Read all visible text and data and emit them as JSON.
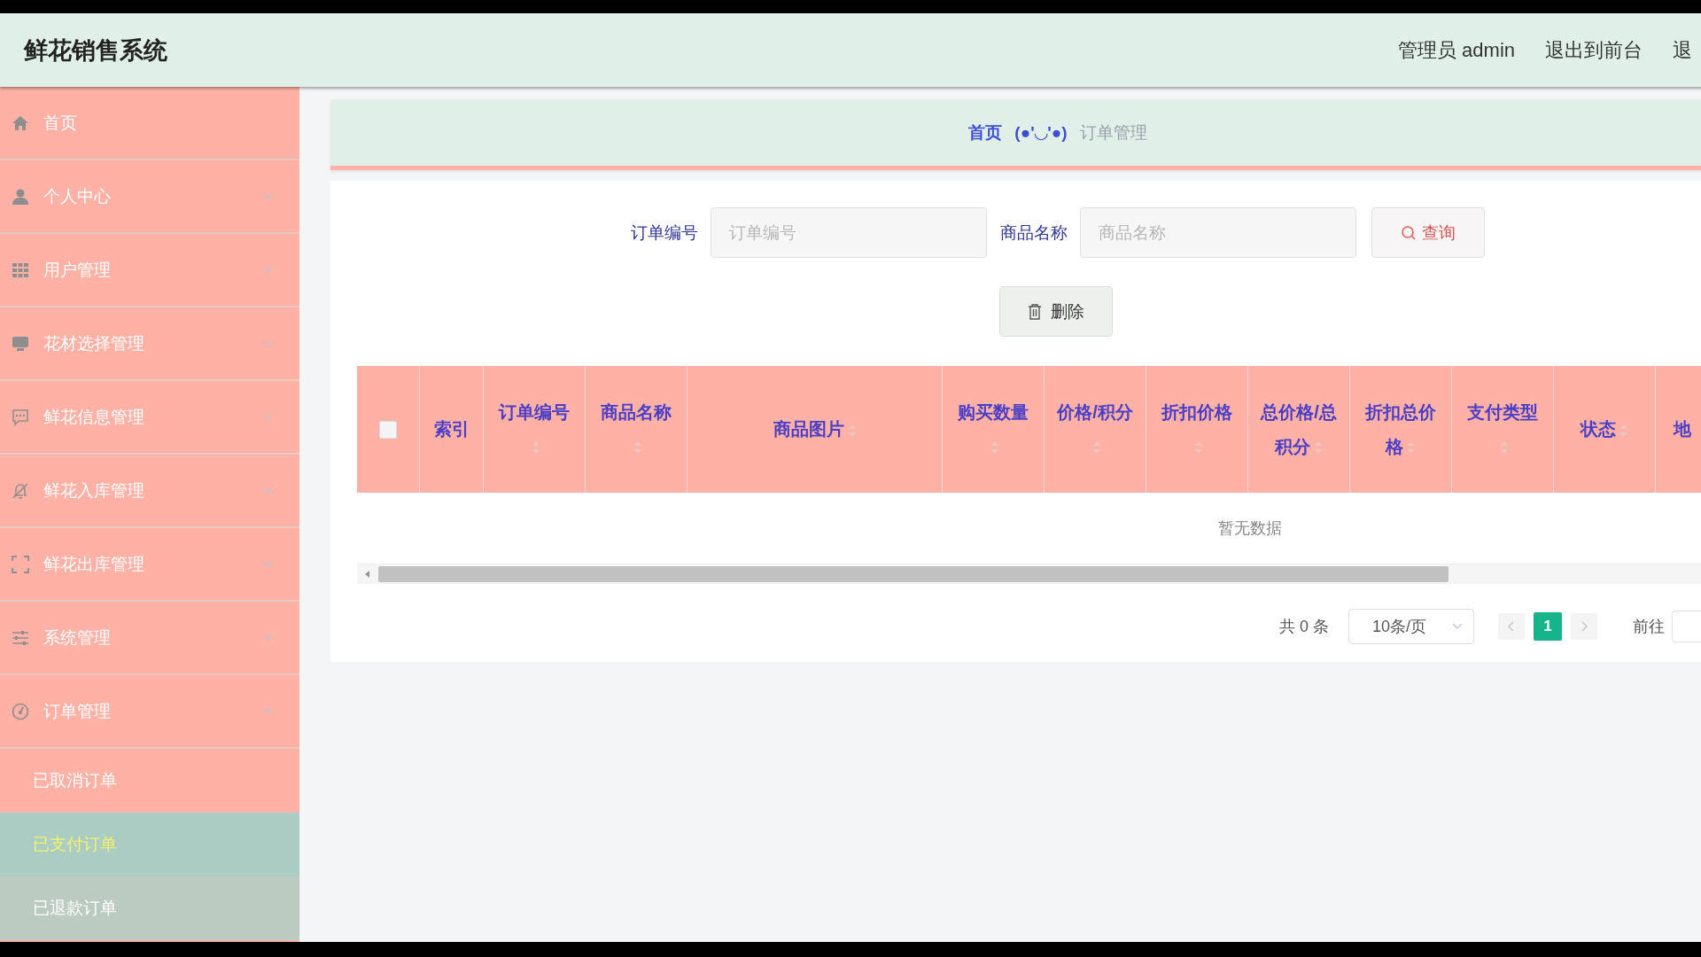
{
  "header": {
    "title": "鲜花销售系统",
    "links": [
      "管理员 admin",
      "退出到前台",
      "退"
    ]
  },
  "sidebar": {
    "items": [
      {
        "label": "首页",
        "expandable": false,
        "expanded": false
      },
      {
        "label": "个人中心",
        "expandable": true,
        "expanded": false
      },
      {
        "label": "用户管理",
        "expandable": true,
        "expanded": false
      },
      {
        "label": "花材选择管理",
        "expandable": true,
        "expanded": false
      },
      {
        "label": "鲜花信息管理",
        "expandable": true,
        "expanded": false
      },
      {
        "label": "鲜花入库管理",
        "expandable": true,
        "expanded": false
      },
      {
        "label": "鲜花出库管理",
        "expandable": true,
        "expanded": false
      },
      {
        "label": "系统管理",
        "expandable": true,
        "expanded": false
      },
      {
        "label": "订单管理",
        "expandable": true,
        "expanded": true,
        "children": [
          {
            "label": "已取消订单",
            "selected": false,
            "hovered": false
          },
          {
            "label": "已支付订单",
            "selected": true,
            "hovered": false
          },
          {
            "label": "已退款订单",
            "selected": false,
            "hovered": true
          }
        ]
      }
    ]
  },
  "breadcrumb": {
    "home": "首页",
    "separator": "(●'◡'●)",
    "current": "订单管理"
  },
  "search": {
    "fields": [
      {
        "label": "订单编号",
        "placeholder": "订单编号"
      },
      {
        "label": "商品名称",
        "placeholder": "商品名称"
      }
    ],
    "button": "查询"
  },
  "delete_button": "删除",
  "table": {
    "header_checkbox": {
      "checked": false
    },
    "columns": [
      {
        "label": "索引",
        "sortable": false,
        "kind": "index"
      },
      {
        "label": "订单编号",
        "sortable": true,
        "kind": "text"
      },
      {
        "label": "商品名称",
        "sortable": true,
        "kind": "text"
      },
      {
        "label": "商品图片",
        "sortable": true,
        "kind": "image"
      },
      {
        "label": "购买数量",
        "sortable": true,
        "kind": "text"
      },
      {
        "label": "价格/积分",
        "sortable": true,
        "kind": "text"
      },
      {
        "label": "折扣价格",
        "sortable": true,
        "kind": "text"
      },
      {
        "label": "总价格/总积分",
        "sortable": true,
        "kind": "text"
      },
      {
        "label": "折扣总价格",
        "sortable": true,
        "kind": "text"
      },
      {
        "label": "支付类型",
        "sortable": true,
        "kind": "text"
      },
      {
        "label": "状态",
        "sortable": true,
        "kind": "text"
      },
      {
        "label": "地",
        "sortable": false,
        "kind": "text"
      }
    ],
    "empty_text": "暂无数据"
  },
  "pagination": {
    "total": "共 0 条",
    "page_size": "10条/页",
    "prev_disabled": true,
    "next_disabled": true,
    "pages": [
      {
        "label": "1",
        "selected": true
      }
    ],
    "jump_label": "前往"
  }
}
